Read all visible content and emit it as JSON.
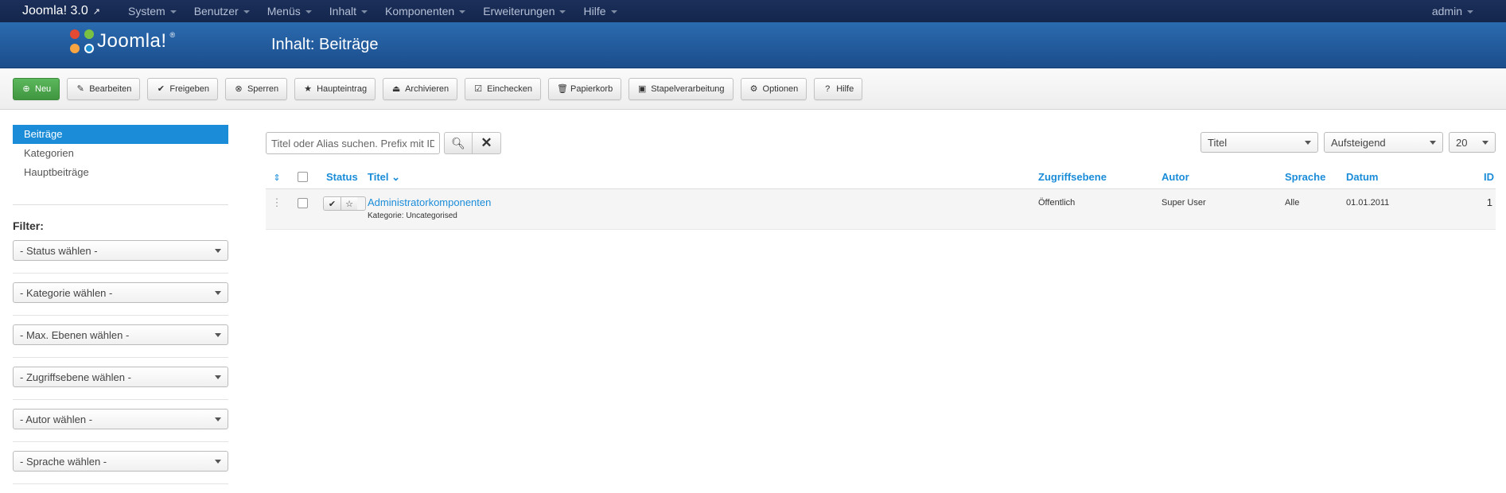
{
  "topbar": {
    "brand": "Joomla! 3.0",
    "menu": [
      "System",
      "Benutzer",
      "Menüs",
      "Inhalt",
      "Komponenten",
      "Erweiterungen",
      "Hilfe"
    ],
    "user": "admin"
  },
  "header": {
    "logo_text": "Joomla!",
    "title": "Inhalt: Beiträge"
  },
  "toolbar": {
    "new": "Neu",
    "edit": "Bearbeiten",
    "publish": "Freigeben",
    "unpublish": "Sperren",
    "featured": "Haupteintrag",
    "archive": "Archivieren",
    "checkin": "Einchecken",
    "trash": "Papierkorb",
    "batch": "Stapelverarbeitung",
    "options": "Optionen",
    "help": "Hilfe"
  },
  "sidebar": {
    "links": [
      "Beiträge",
      "Kategorien",
      "Hauptbeiträge"
    ],
    "filter_title": "Filter:",
    "filters": [
      "- Status wählen -",
      "- Kategorie wählen -",
      "- Max. Ebenen wählen -",
      "- Zugriffsebene wählen -",
      "- Autor wählen -",
      "- Sprache wählen -"
    ]
  },
  "search": {
    "placeholder": "Titel oder Alias suchen. Prefix mit ID"
  },
  "sorting": {
    "order_by": "Titel",
    "direction": "Aufsteigend",
    "limit": "20"
  },
  "table": {
    "headers": {
      "status": "Status",
      "title": "Titel",
      "access": "Zugriffsebene",
      "author": "Autor",
      "language": "Sprache",
      "date": "Datum",
      "id": "ID"
    },
    "rows": [
      {
        "title": "Administratorkomponenten",
        "category": "Kategorie: Uncategorised",
        "access": "Öffentlich",
        "author": "Super User",
        "language": "Alle",
        "date": "01.01.2011",
        "id": "1"
      }
    ]
  }
}
